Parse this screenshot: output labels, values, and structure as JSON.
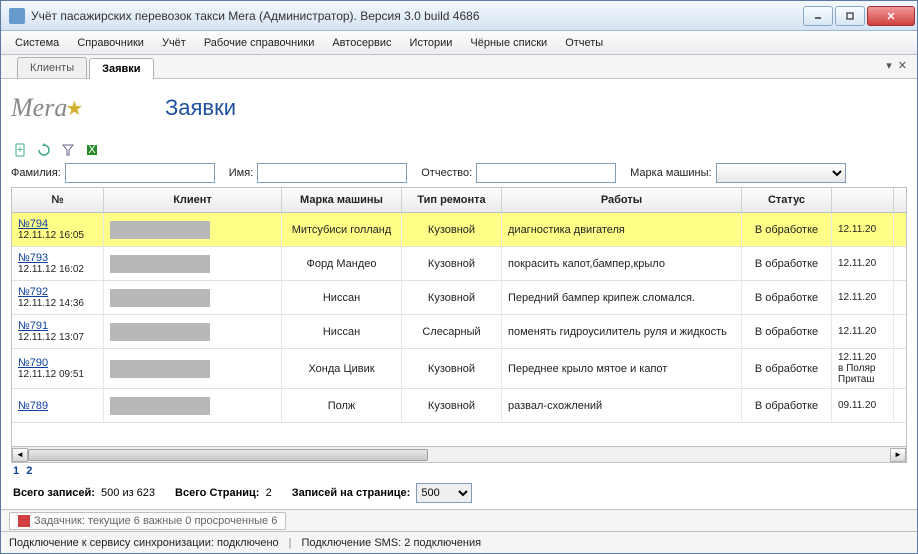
{
  "window": {
    "title": "Учёт пасажирских перевозок такси Mera (Администратор). Версия 3.0 build 4686"
  },
  "menu": [
    "Система",
    "Справочники",
    "Учёт",
    "Рабочие справочники",
    "Автосервис",
    "Истории",
    "Чёрные списки",
    "Отчеты"
  ],
  "tabs": {
    "items": [
      "Клиенты",
      "Заявки"
    ],
    "active": 1
  },
  "page": {
    "logo_text": "Mera",
    "title": "Заявки"
  },
  "filters": {
    "lastname_label": "Фамилия:",
    "lastname_value": "",
    "firstname_label": "Имя:",
    "firstname_value": "",
    "patronymic_label": "Отчество:",
    "patronymic_value": "",
    "carbrand_label": "Марка машины:",
    "carbrand_value": ""
  },
  "grid": {
    "headers": [
      "№",
      "Клиент",
      "Марка машины",
      "Тип ремонта",
      "Работы",
      "Статус",
      ""
    ],
    "rows": [
      {
        "num_label": "№794",
        "num_date": "12.11.12 16:05",
        "car": "Митсубиси голланд",
        "fix": "Кузовной",
        "work": "диагностика двигателя",
        "status": "В обработке",
        "date": "12.11.20",
        "date2": "",
        "date3": "",
        "selected": true
      },
      {
        "num_label": "№793",
        "num_date": "12.11.12 16:02",
        "car": "Форд Мандео",
        "fix": "Кузовной",
        "work": "покрасить капот,бампер,крыло",
        "status": "В обработке",
        "date": "12.11.20",
        "date2": "",
        "date3": ""
      },
      {
        "num_label": "№792",
        "num_date": "12.11.12 14:36",
        "car": "Ниссан",
        "fix": "Кузовной",
        "work": "Передний бампер крипеж сломался.",
        "status": "В обработке",
        "date": "12.11.20",
        "date2": "",
        "date3": ""
      },
      {
        "num_label": "№791",
        "num_date": "12.11.12 13:07",
        "car": "Ниссан",
        "fix": "Слесарный",
        "work": "поменять гидроусилитель руля и жидкость",
        "status": "В обработке",
        "date": "12.11.20",
        "date2": "",
        "date3": ""
      },
      {
        "num_label": "№790",
        "num_date": "12.11.12 09:51",
        "car": "Хонда Цивик",
        "fix": "Кузовной",
        "work": "Переднее крыло мятое и капот",
        "status": "В обработке",
        "date": "12.11.20",
        "date2": "в Поляр",
        "date3": "Приташ"
      },
      {
        "num_label": "№789",
        "num_date": "",
        "car": "Полж",
        "fix": "Кузовной",
        "work": "развал-схожлений",
        "status": "В обработке",
        "date": "09.11.20",
        "date2": "",
        "date3": ""
      }
    ]
  },
  "paging": {
    "pages": [
      "1",
      "2"
    ],
    "total_label": "Всего записей:",
    "total_value": "500 из 623",
    "pages_label": "Всего Страниц:",
    "pages_value": "2",
    "perpage_label": "Записей на странице:",
    "perpage_value": "500"
  },
  "taskbar": {
    "text": "Задачник: текущие 6 важные 0 просроченные 6"
  },
  "status": {
    "sync_label": "Подключение к сервису синхронизации:",
    "sync_value": "подключено",
    "sms_label": "Подключение SMS:",
    "sms_value": "2 подключения"
  }
}
